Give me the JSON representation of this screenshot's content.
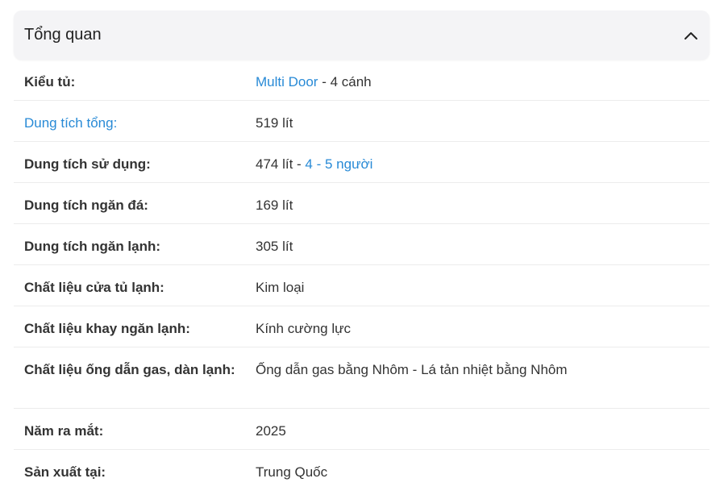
{
  "section": {
    "title": "Tổng quan"
  },
  "specs": {
    "door_type": {
      "label": "Kiểu tủ:",
      "value_link": "Multi Door",
      "value_rest": " - 4 cánh"
    },
    "total_capacity": {
      "label": "Dung tích tổng:",
      "value": "519 lít"
    },
    "usable_capacity": {
      "label": "Dung tích sử dụng:",
      "value_plain": "474 lít - ",
      "value_link": "4 - 5 người"
    },
    "freezer_capacity": {
      "label": "Dung tích ngăn đá:",
      "value": "169 lít"
    },
    "fridge_capacity": {
      "label": "Dung tích ngăn lạnh:",
      "value": "305 lít"
    },
    "door_material": {
      "label": "Chất liệu cửa tủ lạnh:",
      "value": "Kim loại"
    },
    "tray_material": {
      "label": "Chất liệu khay ngăn lạnh:",
      "value": "Kính cường lực"
    },
    "gas_pipe_material": {
      "label": "Chất liệu ống dẫn gas, dàn lạnh:",
      "value": "Ống dẫn gas bằng Nhôm - Lá tản nhiệt bằng Nhôm"
    },
    "release_year": {
      "label": "Năm ra mắt:",
      "value": "2025"
    },
    "made_in": {
      "label": "Sản xuất tại:",
      "value": "Trung Quốc"
    }
  },
  "colors": {
    "link": "#288ad6",
    "text": "#333333",
    "header_bg": "#f4f4f6",
    "divider": "#ececec"
  },
  "icons": {
    "collapse": "chevron-up-icon"
  }
}
